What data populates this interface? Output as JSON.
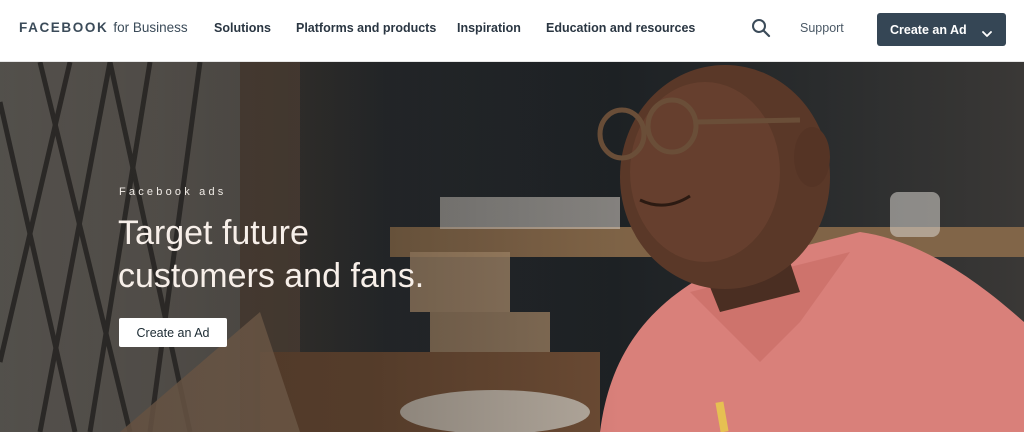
{
  "header": {
    "brand_word": "FACEBOOK",
    "brand_sub": "for Business",
    "nav": [
      {
        "label": "Solutions"
      },
      {
        "label": "Platforms and products"
      },
      {
        "label": "Inspiration"
      },
      {
        "label": "Education and resources"
      }
    ],
    "support_label": "Support",
    "cta_label": "Create an Ad",
    "icons": {
      "search": "search-icon",
      "dropdown": "chevron-down-icon"
    }
  },
  "hero": {
    "eyebrow": "Facebook ads",
    "headline_line1": "Target future",
    "headline_line2": "customers and fans.",
    "button_label": "Create an Ad"
  },
  "colors": {
    "cta_background": "#354655",
    "brand_text": "#3b4b59",
    "hero_text": "#f7efe9",
    "shirt": "#d9807a"
  }
}
